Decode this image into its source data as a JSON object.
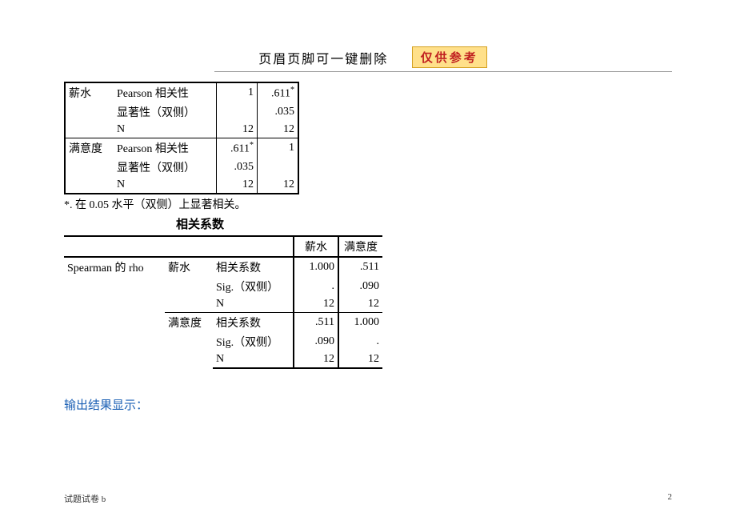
{
  "header": {
    "text": "页眉页脚可一键删除",
    "badge": "仅供参考"
  },
  "table1": {
    "rows": [
      {
        "var": "薪水",
        "stat": "Pearson 相关性",
        "v1": "1",
        "v2": ".611",
        "v2sup": "*"
      },
      {
        "var": "",
        "stat": "显著性（双侧）",
        "v1": "",
        "v2": ".035"
      },
      {
        "var": "",
        "stat": "N",
        "v1": "12",
        "v2": "12"
      },
      {
        "var": "满意度",
        "stat": "Pearson 相关性",
        "v1": ".611",
        "v1sup": "*",
        "v2": "1"
      },
      {
        "var": "",
        "stat": "显著性（双侧）",
        "v1": ".035",
        "v2": ""
      },
      {
        "var": "",
        "stat": "N",
        "v1": "12",
        "v2": "12"
      }
    ],
    "note": "*. 在 0.05 水平（双侧）上显著相关。"
  },
  "table2": {
    "title": "相关系数",
    "header": {
      "c1": "薪水",
      "c2": "满意度"
    },
    "method": "Spearman 的 rho",
    "groups": [
      {
        "var": "薪水",
        "rows": [
          {
            "stat": "相关系数",
            "v1": "1.000",
            "v2": ".511"
          },
          {
            "stat": "Sig.（双侧）",
            "v1": ".",
            "v2": ".090"
          },
          {
            "stat": "N",
            "v1": "12",
            "v2": "12"
          }
        ]
      },
      {
        "var": "满意度",
        "rows": [
          {
            "stat": "相关系数",
            "v1": ".511",
            "v2": "1.000"
          },
          {
            "stat": "Sig.（双侧）",
            "v1": ".090",
            "v2": "."
          },
          {
            "stat": "N",
            "v1": "12",
            "v2": "12"
          }
        ]
      }
    ]
  },
  "output_label": "输出结果显示：",
  "footer": {
    "left": "试题试卷 b",
    "page": "2"
  }
}
